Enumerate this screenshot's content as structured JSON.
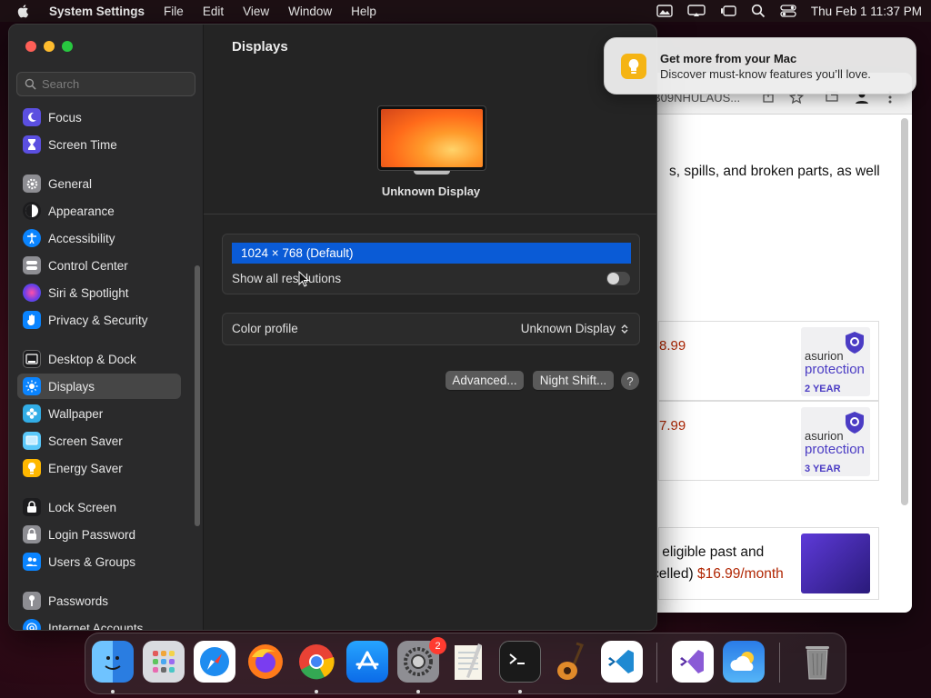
{
  "menubar": {
    "app_name": "System Settings",
    "menus": [
      "File",
      "Edit",
      "View",
      "Window",
      "Help"
    ],
    "clock": "Thu Feb 1  11:37 PM"
  },
  "browser": {
    "url": "B09NHULAUS...",
    "body_text": "s, spills, and broken parts, as well",
    "plans": [
      {
        "price": "8.99",
        "logo_line1": "asurion",
        "logo_line2": "protection",
        "term": "2 YEAR"
      },
      {
        "price": "7.99",
        "logo_line1": "asurion",
        "logo_line2": "protection",
        "term": "3 YEAR"
      }
    ],
    "promo_line1": "ll eligible past and",
    "promo_line2_prefix": "celled) ",
    "promo_price": "$16.99/month"
  },
  "settings": {
    "search_placeholder": "Search",
    "sidebar": [
      {
        "label": "Focus",
        "icon": "moon-icon",
        "color": "#5b4fe0"
      },
      {
        "label": "Screen Time",
        "icon": "hourglass-icon",
        "color": "#5b4fe0"
      },
      {
        "label": "General",
        "icon": "gear-icon",
        "color": "#8e8e93"
      },
      {
        "label": "Appearance",
        "icon": "appearance-icon",
        "color": "#1c1c1e"
      },
      {
        "label": "Accessibility",
        "icon": "accessibility-icon",
        "color": "#0a84ff"
      },
      {
        "label": "Control Center",
        "icon": "control-center-icon",
        "color": "#8e8e93"
      },
      {
        "label": "Siri & Spotlight",
        "icon": "siri-icon",
        "color": "#b04cd9"
      },
      {
        "label": "Privacy & Security",
        "icon": "hand-icon",
        "color": "#0a84ff"
      },
      {
        "label": "Desktop & Dock",
        "icon": "dock-icon",
        "color": "#1c1c1e"
      },
      {
        "label": "Displays",
        "icon": "sun-icon",
        "color": "#0a84ff"
      },
      {
        "label": "Wallpaper",
        "icon": "flower-icon",
        "color": "#32ade6"
      },
      {
        "label": "Screen Saver",
        "icon": "screen-saver-icon",
        "color": "#5ac8fa"
      },
      {
        "label": "Energy Saver",
        "icon": "bulb-icon",
        "color": "#ffb800"
      },
      {
        "label": "Lock Screen",
        "icon": "lock-icon",
        "color": "#1c1c1e"
      },
      {
        "label": "Login Password",
        "icon": "lock-icon",
        "color": "#8e8e93"
      },
      {
        "label": "Users & Groups",
        "icon": "users-icon",
        "color": "#0a84ff"
      },
      {
        "label": "Passwords",
        "icon": "key-icon",
        "color": "#8e8e93"
      },
      {
        "label": "Internet Accounts",
        "icon": "at-icon",
        "color": "#0a84ff"
      }
    ],
    "selected_index": 9,
    "content": {
      "title": "Displays",
      "display_name": "Unknown Display",
      "resolution_selected": "1024 × 768 (Default)",
      "show_all_label": "Show all resolutions",
      "show_all_enabled": false,
      "color_profile_label": "Color profile",
      "color_profile_value": "Unknown Display",
      "advanced_button": "Advanced...",
      "night_shift_button": "Night Shift...",
      "help_button": "?"
    }
  },
  "notification": {
    "title": "Get more from your Mac",
    "body": "Discover must-know features you’ll love."
  },
  "dock": {
    "apps": [
      "Finder",
      "Launchpad",
      "Safari",
      "Firefox",
      "Chrome",
      "App Store",
      "System Settings",
      "TextEdit",
      "Terminal",
      "GarageBand",
      "VS Code",
      "Visual Studio",
      "Weather",
      "Trash"
    ],
    "settings_badge": "2"
  }
}
